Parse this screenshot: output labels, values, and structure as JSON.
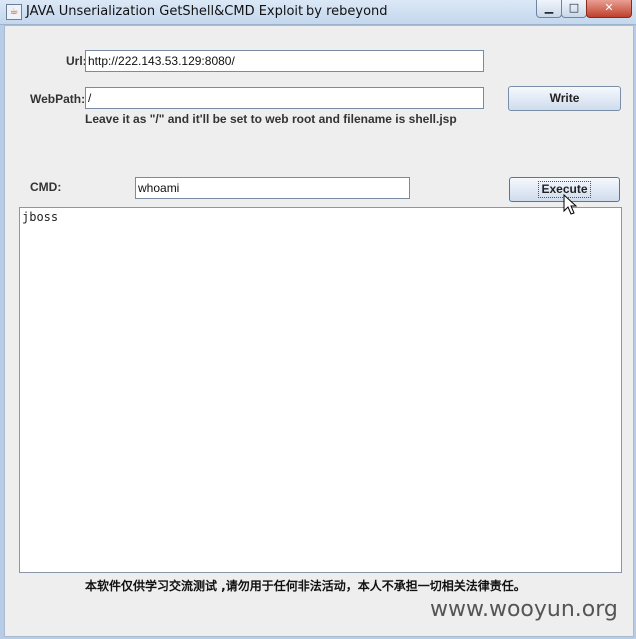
{
  "window": {
    "title": "JAVA Unserialization GetShell&CMD Exploit",
    "author": "by rebeyond",
    "icon": "java-app-icon",
    "controls": {
      "minimize": "▭",
      "maximize": "□",
      "close": "✕"
    }
  },
  "form": {
    "url_label": "Url:",
    "url_value": "http://222.143.53.129:8080/",
    "webpath_label": "WebPath:",
    "webpath_value": "/",
    "write_label": "Write",
    "hint": "Leave it as \"/\" and it'll be set to web root and filename is shell.jsp",
    "cmd_label": "CMD:",
    "cmd_value": "whoami",
    "execute_label": "Execute"
  },
  "output": {
    "text": "jboss"
  },
  "disclaimer": "本软件仅供学习交流测试 ,请勿用于任何非法活动，本人不承担一切相关法律责任。",
  "watermark": "www.wooyun.org"
}
